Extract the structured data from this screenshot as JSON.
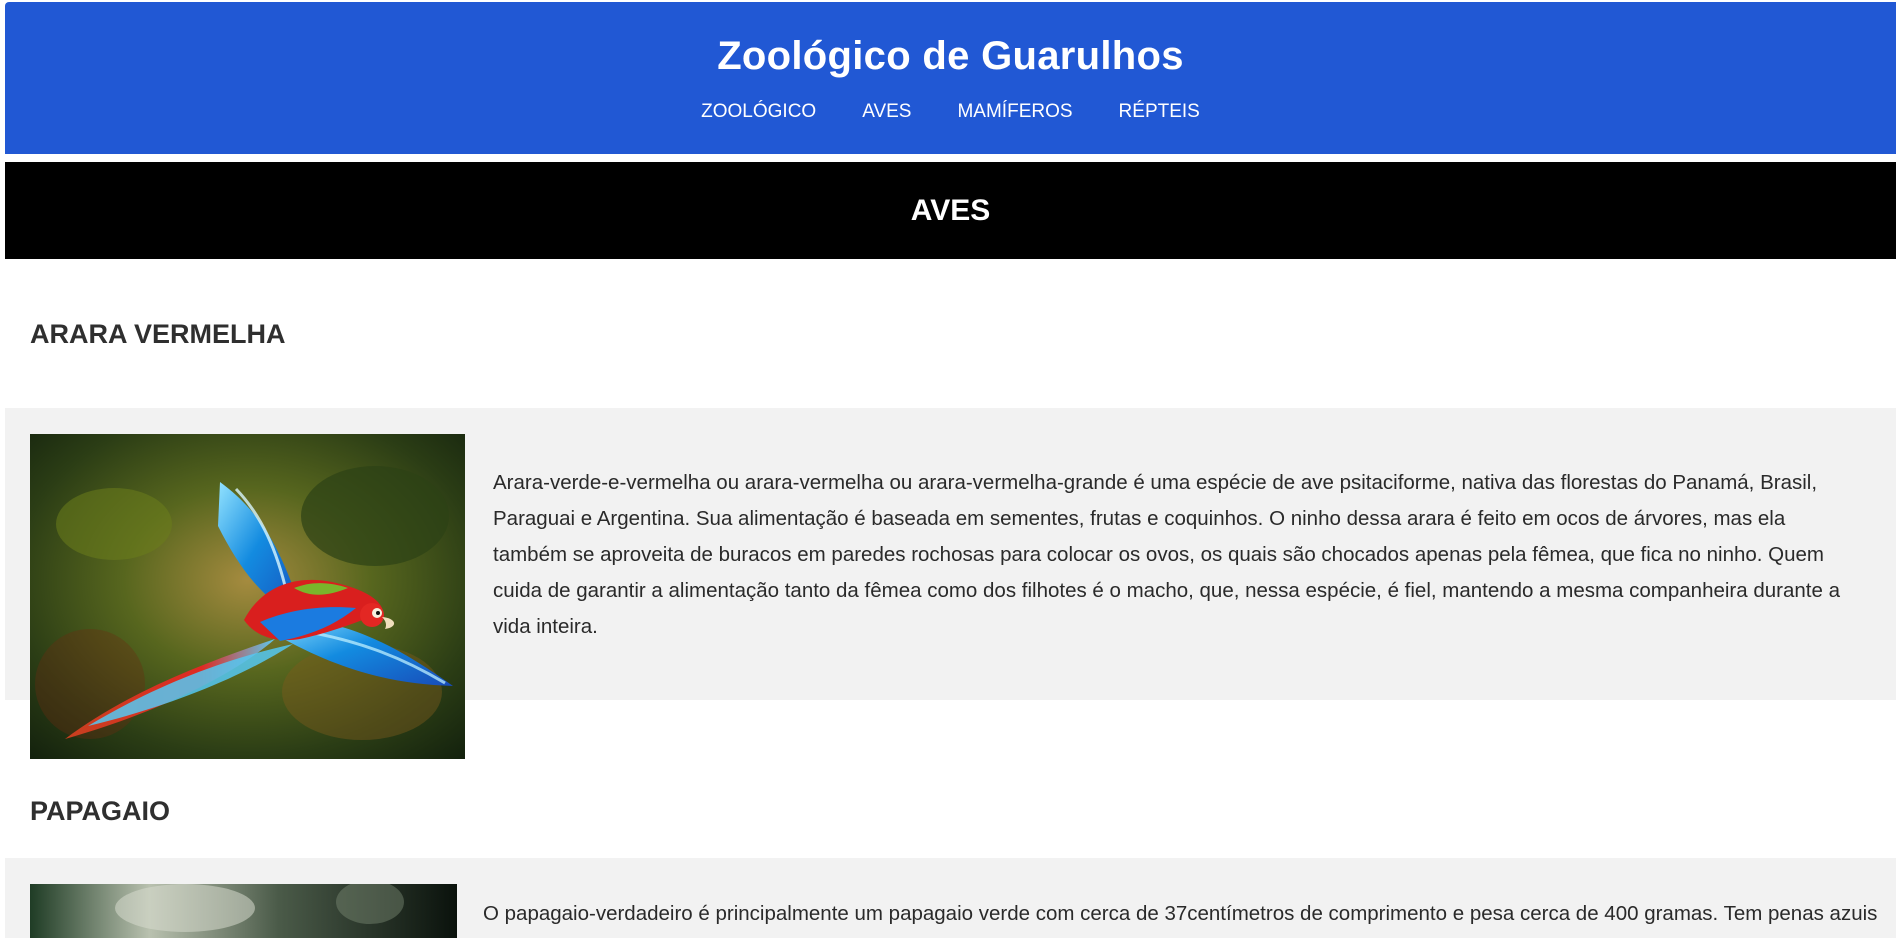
{
  "site": {
    "title": "Zoológico de Guarulhos",
    "nav": [
      "ZOOLÓGICO",
      "AVES",
      "MAMÍFEROS",
      "RÉPTEIS"
    ]
  },
  "section": {
    "title": "AVES"
  },
  "animals": [
    {
      "name": "ARARA VERMELHA",
      "image": "scarlet-macaw-flying-photo",
      "description": "Arara-verde-e-vermelha ou arara-vermelha ou arara-vermelha-grande é uma espécie de ave psitaciforme, nativa das florestas do Panamá, Brasil, Paraguai e Argentina. Sua alimentação é baseada em sementes, frutas e coquinhos. O ninho dessa arara é feito em ocos de árvores, mas ela também se aproveita de buracos em paredes rochosas para colocar os ovos, os quais são chocados apenas pela fêmea, que fica no ninho. Quem cuida de garantir a alimentação tanto da fêmea como dos filhotes é o macho, que, nessa espécie, é fiel, mantendo a mesma companheira durante a vida inteira."
    },
    {
      "name": "PAPAGAIO",
      "image": "parrot-photo",
      "description": "O papagaio-verdadeiro é principalmente um papagaio verde com cerca de 37centímetros de comprimento e pesa cerca de 400 gramas. Tem penas azuis"
    }
  ],
  "colors": {
    "header": "#2158d4",
    "section_band": "#000000",
    "content_band": "#f2f2f2",
    "heading_text": "#2f2f2f"
  }
}
